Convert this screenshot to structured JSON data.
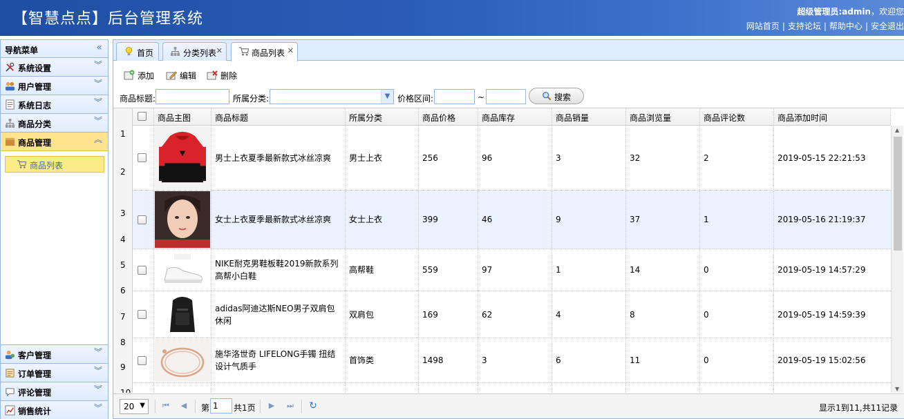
{
  "header": {
    "title": "【智慧点点】后台管理系统",
    "welcome_prefix": "超级管理员:admin",
    "welcome_suffix": "，欢迎您",
    "links": [
      "网站首页",
      "支持论坛",
      "帮助中心",
      "安全退出"
    ]
  },
  "sidebar": {
    "title": "导航菜单",
    "items_top": [
      {
        "label": "系统设置",
        "icon": "tools-icon"
      },
      {
        "label": "用户管理",
        "icon": "users-icon"
      },
      {
        "label": "系统日志",
        "icon": "log-icon"
      },
      {
        "label": "商品分类",
        "icon": "category-icon"
      },
      {
        "label": "商品管理",
        "icon": "goods-icon",
        "active": true
      }
    ],
    "sub_items": [
      {
        "label": "商品列表",
        "icon": "cart-icon"
      }
    ],
    "items_bottom": [
      {
        "label": "客户管理",
        "icon": "customer-icon"
      },
      {
        "label": "订单管理",
        "icon": "order-icon"
      },
      {
        "label": "评论管理",
        "icon": "comment-icon"
      },
      {
        "label": "销售统计",
        "icon": "chart-icon"
      }
    ]
  },
  "tabs": [
    {
      "label": "首页",
      "icon": "bulb-icon",
      "closable": false
    },
    {
      "label": "分类列表",
      "icon": "category-icon",
      "closable": true
    },
    {
      "label": "商品列表",
      "icon": "cart-icon",
      "closable": true,
      "selected": true
    }
  ],
  "toolbar": {
    "add": "添加",
    "edit": "编辑",
    "delete": "删除"
  },
  "search": {
    "title_label": "商品标题:",
    "category_label": "所属分类:",
    "price_label": "价格区间:",
    "tilde": "~",
    "button": "搜索"
  },
  "grid": {
    "columns": [
      "商品主图",
      "商品标题",
      "所属分类",
      "商品价格",
      "商品库存",
      "商品销量",
      "商品浏览量",
      "商品评论数",
      "商品添加时间"
    ],
    "row_numbers": [
      "1",
      "2",
      "3",
      "4",
      "5",
      "6",
      "7",
      "8",
      "9",
      "10"
    ],
    "rows": [
      {
        "title": "男士上衣夏季最新款式冰丝凉爽",
        "category": "男士上衣",
        "price": "256",
        "stock": "96",
        "sales": "3",
        "views": "32",
        "comments": "2",
        "time": "2019-05-15 22:21:53"
      },
      {
        "title": "女士上衣夏季最新款式冰丝凉爽",
        "category": "女士上衣",
        "price": "399",
        "stock": "46",
        "sales": "9",
        "views": "37",
        "comments": "1",
        "time": "2019-05-16 21:19:37"
      },
      {
        "title": "NIKE耐克男鞋板鞋2019新款系列高帮小白鞋",
        "category": "高帮鞋",
        "price": "559",
        "stock": "97",
        "sales": "1",
        "views": "14",
        "comments": "0",
        "time": "2019-05-19 14:57:29"
      },
      {
        "title": "adidas阿迪达斯NEO男子双肩包休闲",
        "category": "双肩包",
        "price": "169",
        "stock": "62",
        "sales": "4",
        "views": "8",
        "comments": "0",
        "time": "2019-05-19 14:59:39"
      },
      {
        "title": "施华洛世奇 LIFELONG手镯 扭结设计气质手",
        "category": "首饰类",
        "price": "1498",
        "stock": "3",
        "sales": "6",
        "views": "11",
        "comments": "0",
        "time": "2019-05-19 15:02:56"
      }
    ]
  },
  "pager": {
    "page_size": "20",
    "page_label": "第",
    "page_value": "1",
    "total_pages": "共1页",
    "info": "显示1到11,共11记录"
  },
  "colors": {
    "header": "#2a5cb8",
    "border": "#95b8e7",
    "active_menu": "#ffe48d",
    "selected_row": "#eaf2ff"
  }
}
